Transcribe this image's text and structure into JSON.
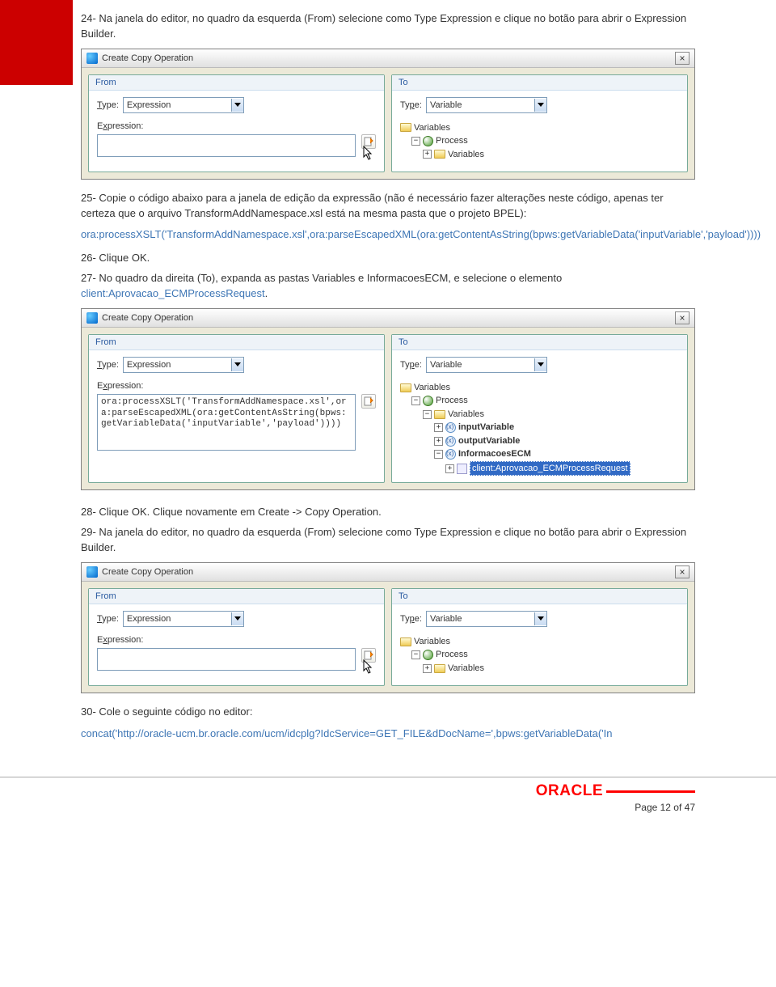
{
  "steps": {
    "s24": "24- Na janela do editor, no quadro da esquerda (From) selecione como Type Expression e clique no botão para abrir o Expression Builder.",
    "s25": "25- Copie o código abaixo para a janela de edição da expressão (não é necessário fazer alterações neste código, apenas ter certeza que o arquivo TransformAddNamespace.xsl está na mesma pasta que o projeto BPEL):",
    "s25code": "ora:processXSLT('TransformAddNamespace.xsl',ora:parseEscapedXML(ora:getContentAsString(bpws:getVariableData('inputVariable','payload'))))",
    "s26": "26- Clique OK.",
    "s27a": "27- No quadro da direita (To), expanda as pastas Variables e InformacoesECM, e selecione o elemento ",
    "s27b": "client:Aprovacao_ECMProcessRequest",
    "s27c": ".",
    "s28": "28- Clique OK. Clique novamente em Create -> Copy Operation.",
    "s29": "29- Na janela do editor, no quadro da esquerda (From) selecione como Type Expression e clique no botão para abrir o Expression Builder.",
    "s30": "30- Cole o seguinte código no editor:",
    "s30code": "concat('http://oracle-ucm.br.oracle.com/ucm/idcplg?IdcService=GET_FILE&dDocName=',bpws:getVariableData('In"
  },
  "dialog": {
    "title": "Create Copy Operation",
    "close": "×",
    "from": {
      "legend": "From",
      "typeLabel": "Type:",
      "typeValue": "Expression",
      "exprLabel": "Expression:"
    },
    "to": {
      "legend": "To",
      "typeLabel": "Type:",
      "typeValue": "Variable"
    }
  },
  "dialog2": {
    "exprContent": "ora:processXSLT('TransformAddNamespace.xsl',ora:parseEscapedXML(ora:getContentAsString(bpws:getVariableData('inputVariable','payload'))))"
  },
  "tree1": {
    "variables": "Variables",
    "process": "Process",
    "variables2": "Variables"
  },
  "tree2": {
    "variables": "Variables",
    "process": "Process",
    "variables2": "Variables",
    "inputVariable": "inputVariable",
    "outputVariable": "outputVariable",
    "informacoesECM": "InformacoesECM",
    "selected": "client:Aprovacao_ECMProcessRequest"
  },
  "footer": {
    "logo": "ORACLE",
    "page": "Page 12 of 47"
  }
}
